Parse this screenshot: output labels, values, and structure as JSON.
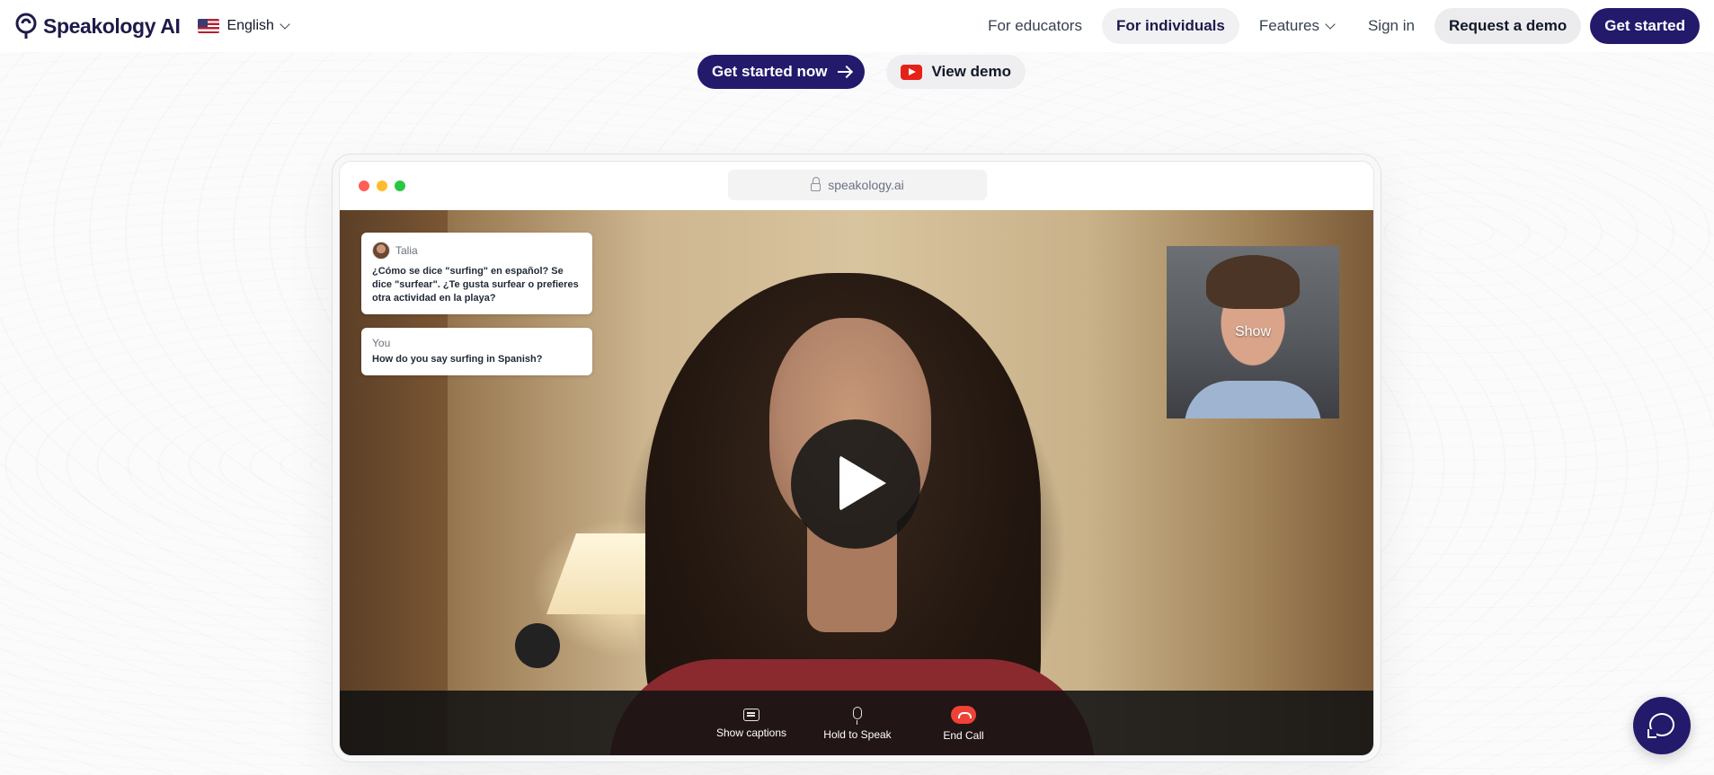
{
  "nav": {
    "brand": "Speakology AI",
    "language": "English",
    "links": [
      {
        "label": "For educators"
      },
      {
        "label": "For individuals"
      },
      {
        "label": "Features"
      },
      {
        "label": "Sign in"
      }
    ],
    "request_demo": "Request a demo",
    "get_started": "Get started"
  },
  "hero": {
    "primary_cta": "Get started now",
    "secondary_cta": "View demo"
  },
  "browser": {
    "url": "speakology.ai",
    "dot_colors": [
      "#ff5f57",
      "#febc2e",
      "#28c840"
    ]
  },
  "call": {
    "messages": [
      {
        "sender": "Talia",
        "text": "¿Cómo se dice \"surfing\" en español? Se dice \"surfear\". ¿Te gusta surfear o prefieres otra actividad en la playa?"
      },
      {
        "sender": "You",
        "text": "How do you say surfing in Spanish?"
      }
    ],
    "self_view_label": "Show",
    "controls": [
      {
        "label": "Show captions",
        "icon": "captions-icon"
      },
      {
        "label": "Hold to Speak",
        "icon": "microphone-icon"
      },
      {
        "label": "End Call",
        "icon": "end-call-icon"
      }
    ]
  },
  "colors": {
    "brand": "#231a6b",
    "end_call": "#ef4136",
    "youtube": "#e62117"
  }
}
